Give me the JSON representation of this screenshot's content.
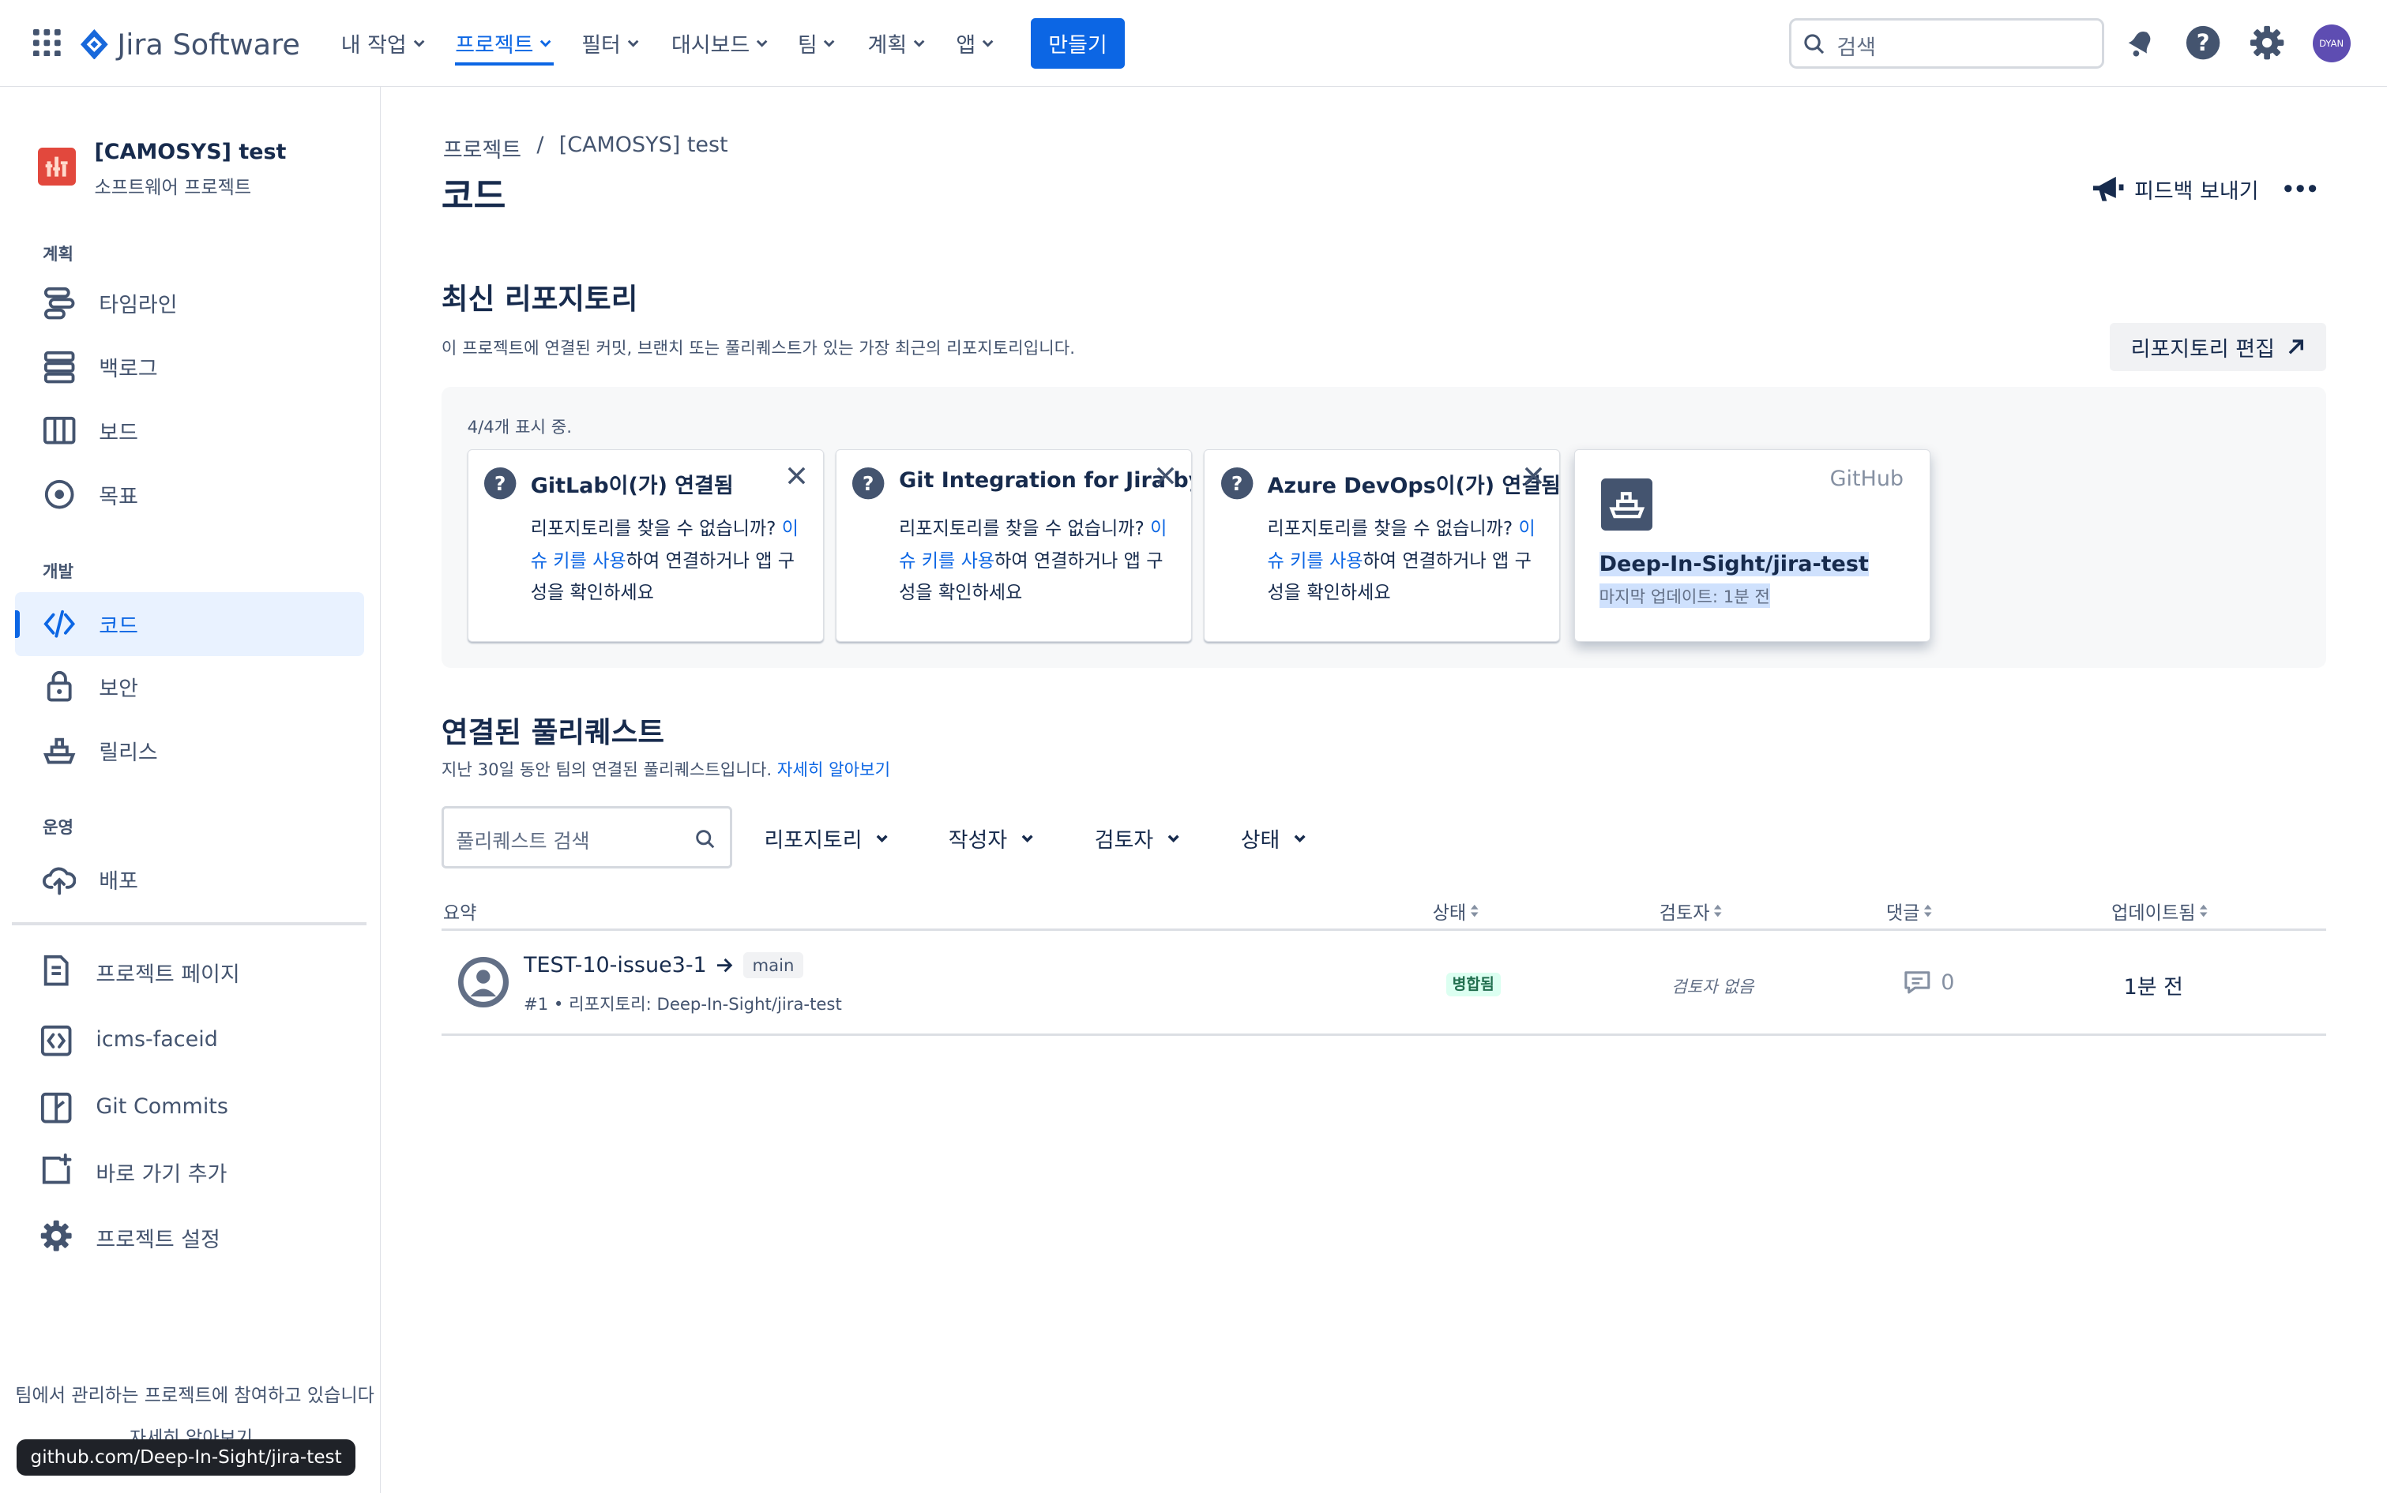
{
  "topnav": {
    "product": "Jira Software",
    "items": [
      {
        "label": "내 작업"
      },
      {
        "label": "프로젝트"
      },
      {
        "label": "필터"
      },
      {
        "label": "대시보드"
      },
      {
        "label": "팀"
      },
      {
        "label": "계획"
      },
      {
        "label": "앱"
      }
    ],
    "create_label": "만들기",
    "search_placeholder": "검색",
    "avatar_initials": "DYAN"
  },
  "project": {
    "name": "[CAMOSYS] test",
    "type": "소프트웨어 프로젝트"
  },
  "sidebar": {
    "sections": [
      {
        "label": "계획",
        "items": [
          {
            "label": "타임라인",
            "icon": "timeline-icon"
          },
          {
            "label": "백로그",
            "icon": "backlog-icon"
          },
          {
            "label": "보드",
            "icon": "board-icon"
          },
          {
            "label": "목표",
            "icon": "goal-icon"
          }
        ]
      },
      {
        "label": "개발",
        "items": [
          {
            "label": "코드",
            "icon": "code-icon",
            "active": true
          },
          {
            "label": "보안",
            "icon": "lock-icon"
          },
          {
            "label": "릴리스",
            "icon": "ship-icon"
          }
        ]
      },
      {
        "label": "운영",
        "items": [
          {
            "label": "배포",
            "icon": "cloud-upload-icon"
          }
        ]
      }
    ],
    "links": [
      {
        "label": "프로젝트 페이지",
        "icon": "page-icon"
      },
      {
        "label": "icms-faceid",
        "icon": "code-brackets-icon"
      },
      {
        "label": "Git Commits",
        "icon": "git-commits-icon"
      },
      {
        "label": "바로 가기 추가",
        "icon": "add-shortcut-icon"
      },
      {
        "label": "프로젝트 설정",
        "icon": "gear-icon"
      }
    ],
    "footer_text": "팀에서 관리하는 프로젝트에 참여하고 있습니다",
    "footer_link": "자세히 알아보기",
    "url_tooltip": "github.com/Deep-In-Sight/jira-test"
  },
  "breadcrumb": {
    "root": "프로젝트",
    "separator": "/",
    "current": "[CAMOSYS] test"
  },
  "page": {
    "title": "코드",
    "feedback_label": "피드백 보내기"
  },
  "repos": {
    "heading": "최신 리포지토리",
    "description": "이 프로젝트에 연결된 커밋, 브랜치 또는 풀리퀘스트가 있는 가장 최근의 리포지토리입니다.",
    "edit_label": "리포지토리 편집",
    "showing": "4/4개 표시 중.",
    "help_prefix": "리포지토리를 찾을 수 없습니까? ",
    "help_link": "이슈 키를 사용",
    "help_suffix": "하여 연결하거나 앱 구성을 확인하세요",
    "cards": [
      {
        "title": "GitLab이(가) 연결됨"
      },
      {
        "title": "Git Integration for Jira by GitKraken"
      },
      {
        "title": "Azure DevOps이(가) 연결됨"
      }
    ],
    "github": {
      "provider": "GitHub",
      "name": "Deep-In-Sight/jira-test",
      "updated": "마지막 업데이트: 1분 전"
    }
  },
  "pulls": {
    "heading": "연결된 풀리퀘스트",
    "description": "지난 30일 동안 팀의 연결된 풀리퀘스트입니다.",
    "learn_more": "자세히 알아보기",
    "search_placeholder": "풀리퀘스트 검색",
    "filters": [
      "리포지토리",
      "작성자",
      "검토자",
      "상태"
    ],
    "columns": {
      "summary": "요약",
      "status": "상태",
      "reviewer": "검토자",
      "comments": "댓글",
      "updated": "업데이트됨"
    },
    "rows": [
      {
        "source_branch": "TEST-10-issue3-1",
        "target_branch": "main",
        "meta": "#1 • 리포지토리: Deep-In-Sight/jira-test",
        "status": "병합됨",
        "reviewer": "검토자 없음",
        "comments": "0",
        "updated": "1분 전"
      }
    ]
  },
  "colors": {
    "brand": "#0c66e4",
    "text": "#172b4d",
    "subtle": "#44546f",
    "merged_bg": "#dcfff1",
    "merged_text": "#216e4e"
  }
}
